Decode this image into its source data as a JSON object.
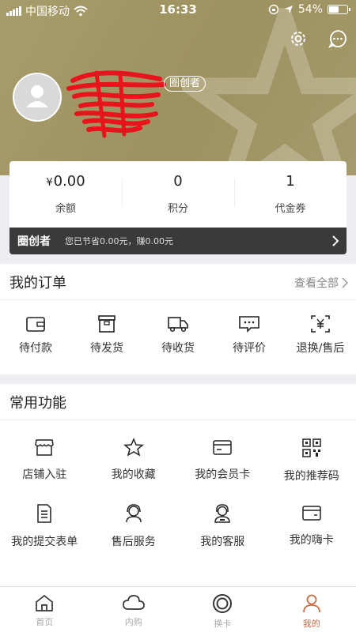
{
  "status_bar": {
    "carrier": "中国移动",
    "time": "16:33",
    "battery": "54%"
  },
  "profile": {
    "role_badge": "圈创者",
    "avatar_icon": "user-icon"
  },
  "header_icons": [
    "gear-icon",
    "message-icon"
  ],
  "account": {
    "balance": {
      "currency": "¥",
      "value": "0.00",
      "label": "余额"
    },
    "points": {
      "value": "0",
      "label": "积分"
    },
    "vouchers": {
      "value": "1",
      "label": "代金券"
    }
  },
  "creator_bar": {
    "title": "圈创者",
    "text": "您已节省0.00元，赚0.00元"
  },
  "orders": {
    "title": "我的订单",
    "view_all": "查看全部",
    "items": [
      {
        "label": "待付款",
        "icon": "wallet-icon"
      },
      {
        "label": "待发货",
        "icon": "package-icon"
      },
      {
        "label": "待收货",
        "icon": "truck-icon"
      },
      {
        "label": "待评价",
        "icon": "comment-icon"
      },
      {
        "label": "退换/售后",
        "icon": "refund-icon"
      }
    ]
  },
  "functions": {
    "title": "常用功能",
    "items": [
      {
        "label": "店铺入驻",
        "icon": "store-icon"
      },
      {
        "label": "我的收藏",
        "icon": "star-icon"
      },
      {
        "label": "我的会员卡",
        "icon": "member-card-icon"
      },
      {
        "label": "我的推荐码",
        "icon": "qr-code-icon"
      },
      {
        "label": "我的提交表单",
        "icon": "form-icon"
      },
      {
        "label": "售后服务",
        "icon": "service-icon"
      },
      {
        "label": "我的客服",
        "icon": "headset-icon"
      },
      {
        "label": "我的嗨卡",
        "icon": "card-icon"
      }
    ]
  },
  "tabbar": [
    {
      "label": "首页",
      "icon": "home-icon",
      "active": false
    },
    {
      "label": "内购",
      "icon": "cloud-icon",
      "active": false
    },
    {
      "label": "换卡",
      "icon": "ring-icon",
      "active": false
    },
    {
      "label": "我的",
      "icon": "person-icon",
      "active": true
    }
  ],
  "colors": {
    "header_bg": "#a89c6a",
    "accent": "#c96a45",
    "creator_bar": "#3a3a3a"
  }
}
